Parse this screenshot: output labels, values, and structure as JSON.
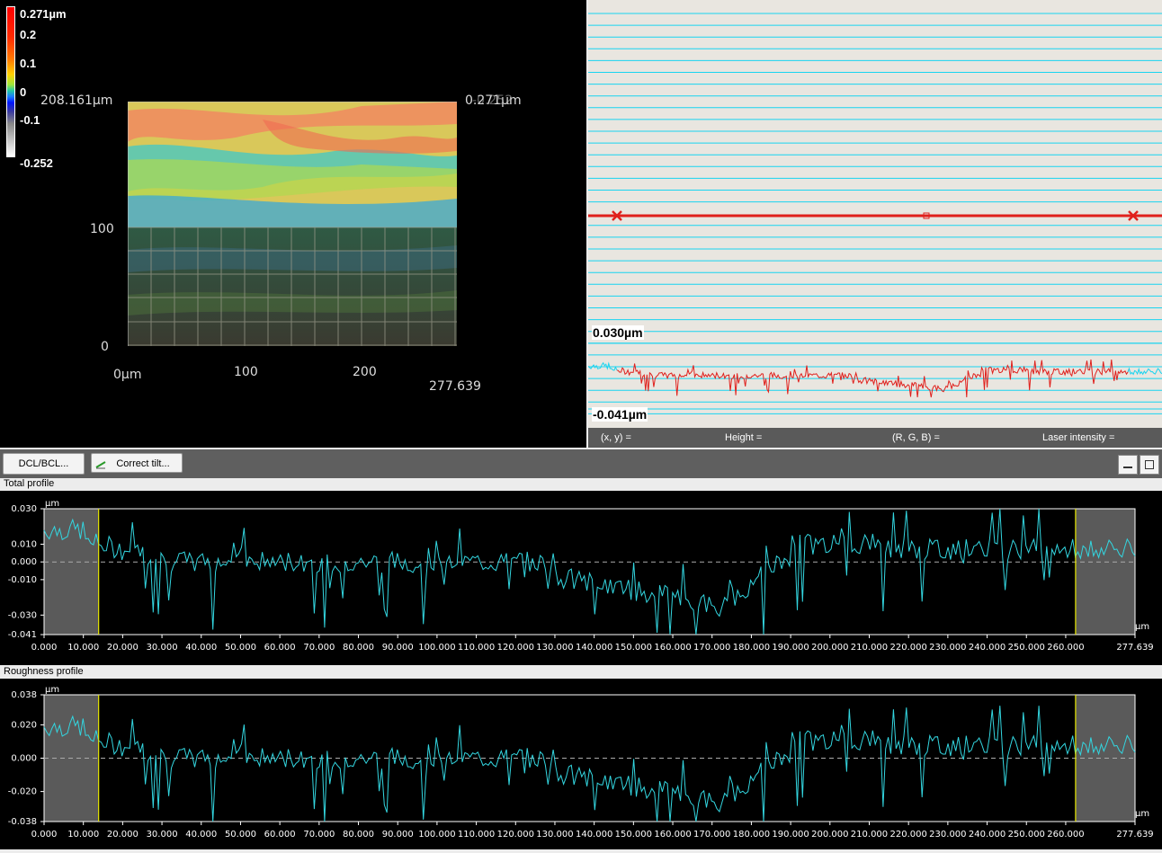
{
  "view3d": {
    "colorbar_labels": [
      "0.271µm",
      "0.2",
      "0.1",
      "0",
      "-0.1",
      "-0.252"
    ],
    "corner_left": "208.161µm",
    "corner_right": "0.271µm",
    "corner_right_b": "-0.252",
    "y_ticks": [
      "100",
      "0"
    ],
    "x_ticks": [
      "0µm",
      "100",
      "200"
    ],
    "x_end": "277.639"
  },
  "image2d": {
    "profile_max": "0.030µm",
    "profile_min": "-0.041µm",
    "status": {
      "xy": "(x, y)  =",
      "height": "Height  =",
      "rgb": "(R, G, B)  =",
      "laser": "Laser intensity  ="
    }
  },
  "toolbar": {
    "dcl_label": "DCL/BCL...",
    "tilt_label": "Correct tilt..."
  },
  "total_profile": {
    "title": "Total profile",
    "y_ticks": [
      "0.030",
      "0.010",
      "0.000",
      "-0.010",
      "-0.030",
      "-0.041"
    ],
    "x_ticks": [
      "0.000",
      "10.000",
      "20.000",
      "30.000",
      "40.000",
      "50.000",
      "60.000",
      "70.000",
      "80.000",
      "90.000",
      "100.000",
      "110.000",
      "120.000",
      "130.000",
      "140.000",
      "150.000",
      "160.000",
      "170.000",
      "180.000",
      "190.000",
      "200.000",
      "210.000",
      "220.000",
      "230.000",
      "240.000",
      "250.000",
      "260.000",
      "277.639"
    ],
    "unit_y": "µm",
    "unit_x": "µm"
  },
  "roughness_profile": {
    "title": "Roughness profile",
    "y_ticks": [
      "0.038",
      "0.020",
      "0.000",
      "-0.020",
      "-0.038"
    ],
    "x_ticks": [
      "0.000",
      "10.000",
      "20.000",
      "30.000",
      "40.000",
      "50.000",
      "60.000",
      "70.000",
      "80.000",
      "90.000",
      "100.000",
      "110.000",
      "120.000",
      "130.000",
      "140.000",
      "150.000",
      "160.000",
      "170.000",
      "180.000",
      "190.000",
      "200.000",
      "210.000",
      "220.000",
      "230.000",
      "240.000",
      "250.000",
      "260.000",
      "277.639"
    ],
    "unit_y": "µm",
    "unit_x": "µm"
  },
  "colors": {
    "profile": "#33d6e0",
    "scan_line": "#19d4f0",
    "marker": "#e0201c",
    "cursor": "#e8e800"
  }
}
